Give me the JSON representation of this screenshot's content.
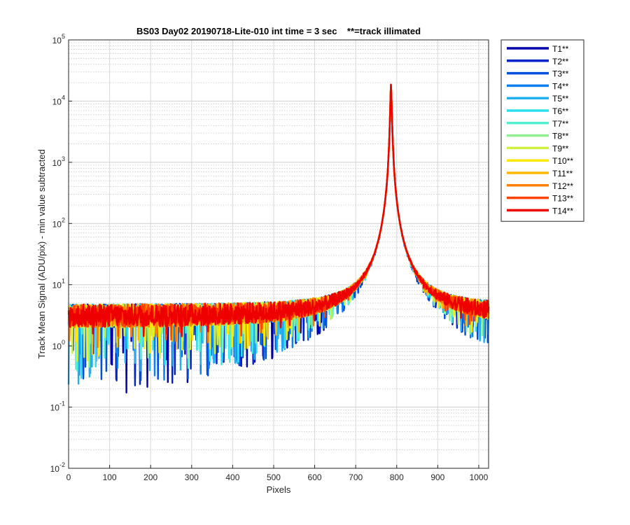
{
  "chart_data": {
    "type": "line",
    "title": "BS03 Day02 20190718-Lite-010 int time = 3 sec    **=track illimated",
    "xlabel": "Pixels",
    "ylabel": "Track Mean Signal (ADU/pix) - min value subtracted",
    "xlim": [
      0,
      1024
    ],
    "ylim": [
      0.01,
      100000
    ],
    "yscale": "log",
    "xticks": [
      "0",
      "100",
      "200",
      "300",
      "400",
      "500",
      "600",
      "700",
      "800",
      "900",
      "1000"
    ],
    "yticks": [
      {
        "base": "10",
        "exp": "-2"
      },
      {
        "base": "10",
        "exp": "-1"
      },
      {
        "base": "10",
        "exp": "0"
      },
      {
        "base": "10",
        "exp": "1"
      },
      {
        "base": "10",
        "exp": "2"
      },
      {
        "base": "10",
        "exp": "3"
      },
      {
        "base": "10",
        "exp": "4"
      },
      {
        "base": "10",
        "exp": "5"
      }
    ],
    "grid": true,
    "legend_position": "outside-top-right",
    "peak": {
      "x": 786,
      "y": 18000
    },
    "baseline_level": 3,
    "series": [
      {
        "name": "T1**",
        "color": "#0000AA"
      },
      {
        "name": "T2**",
        "color": "#0022CC"
      },
      {
        "name": "T3**",
        "color": "#0050E0"
      },
      {
        "name": "T4**",
        "color": "#0A80F0"
      },
      {
        "name": "T5**",
        "color": "#20B0F0"
      },
      {
        "name": "T6**",
        "color": "#2AE0F0"
      },
      {
        "name": "T7**",
        "color": "#50F0D0"
      },
      {
        "name": "T8**",
        "color": "#90F090"
      },
      {
        "name": "T9**",
        "color": "#D0F040"
      },
      {
        "name": "T10**",
        "color": "#FFE800"
      },
      {
        "name": "T11**",
        "color": "#FFB800"
      },
      {
        "name": "T12**",
        "color": "#FF8000"
      },
      {
        "name": "T13**",
        "color": "#FF4000"
      },
      {
        "name": "T14**",
        "color": "#EE0000"
      }
    ]
  }
}
